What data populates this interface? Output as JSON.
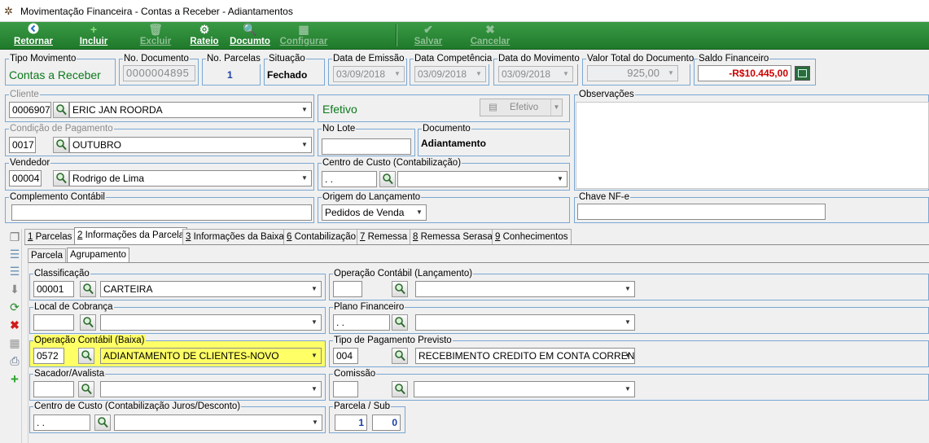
{
  "window": {
    "title": "Movimentação Financeira - Contas a Receber - Adiantamentos"
  },
  "toolbar": {
    "retornar": "Retornar",
    "incluir": "Incluir",
    "excluir": "Excluir",
    "rateio": "Rateio",
    "documento": "Documto",
    "configurar": "Configurar",
    "salvar": "Salvar",
    "cancelar": "Cancelar"
  },
  "header": {
    "tipo_movimento_label": "Tipo Movimento",
    "tipo_movimento": "Contas a Receber",
    "no_documento_label": "No. Documento",
    "no_documento": "0000004895",
    "no_parcelas_label": "No. Parcelas",
    "no_parcelas": "1",
    "situacao_label": "Situação",
    "situacao": "Fechado",
    "data_emissao_label": "Data de Emissão",
    "data_emissao": "03/09/2018",
    "data_competencia_label": "Data Competência",
    "data_competencia": "03/09/2018",
    "data_movimento_label": "Data do Movimento",
    "data_movimento": "03/09/2018",
    "valor_total_label": "Valor Total do Documento",
    "valor_total": "925,00",
    "saldo_label": "Saldo Financeiro",
    "saldo": "-R$10.445,00"
  },
  "form": {
    "cliente_label": "Cliente",
    "cliente_code": "0006907",
    "cliente_name": "ERIC JAN ROORDA",
    "status_text": "Efetivo",
    "status_button": "Efetivo",
    "condicao_label": "Condição de Pagamento",
    "condicao_code": "0017",
    "condicao_name": "OUTUBRO",
    "no_lote_label": "No Lote",
    "no_lote": "",
    "documento_label": "Documento",
    "documento": "Adiantamento",
    "vendedor_label": "Vendedor",
    "vendedor_code": "00004",
    "vendedor_name": "Rodrigo de Lima",
    "centro_custo_label": "Centro de Custo (Contabilização)",
    "centro_custo_code": " .  .",
    "complemento_label": "Complemento Contábil",
    "complemento": "",
    "origem_label": "Origem do Lançamento",
    "origem": "Pedidos de Venda",
    "observacoes_label": "Observações",
    "chave_label": "Chave NF-e",
    "chave": ""
  },
  "tabs": [
    {
      "n": "1",
      "label": " Parcelas"
    },
    {
      "n": "2",
      "label": " Informações da Parcela"
    },
    {
      "n": "3",
      "label": " Informações da Baixa"
    },
    {
      "n": "6",
      "label": " Contabilização"
    },
    {
      "n": "7",
      "label": " Remessa"
    },
    {
      "n": "8",
      "label": " Remessa Serasa"
    },
    {
      "n": "9",
      "label": " Conhecimentos"
    }
  ],
  "subtabs": [
    "Parcela",
    "Agrupamento"
  ],
  "detail": {
    "classificacao_label": "Classificação",
    "classificacao_code": "00001",
    "classificacao_name": "CARTEIRA",
    "op_contabil_lanc_label": "Operação Contábil (Lançamento)",
    "local_cobranca_label": "Local de Cobrança",
    "plano_label": "Plano Financeiro",
    "plano_code": " .  .",
    "op_contabil_baixa_label": "Operação Contábil (Baixa)",
    "op_baixa_code": "0572",
    "op_baixa_name": "ADIANTAMENTO DE CLIENTES-NOVO",
    "tipo_pag_label": "Tipo de Pagamento Previsto",
    "tipo_pag_code": "004",
    "tipo_pag_name": "RECEBIMENTO CREDITO EM CONTA CORRENTE",
    "sacador_label": "Sacador/Avalista",
    "comissao_label": "Comissão",
    "cc_juros_label": "Centro de Custo (Contabilização Juros/Desconto)",
    "cc_juros_code": " .  .",
    "parcela_sub_label": "Parcela / Sub",
    "parcela": "1",
    "sub": "0"
  },
  "colors": {
    "toolbar": "#2b8a37",
    "highlight": "#ffff66",
    "saldo": "#cc0000",
    "status": "#0a7a1a"
  }
}
